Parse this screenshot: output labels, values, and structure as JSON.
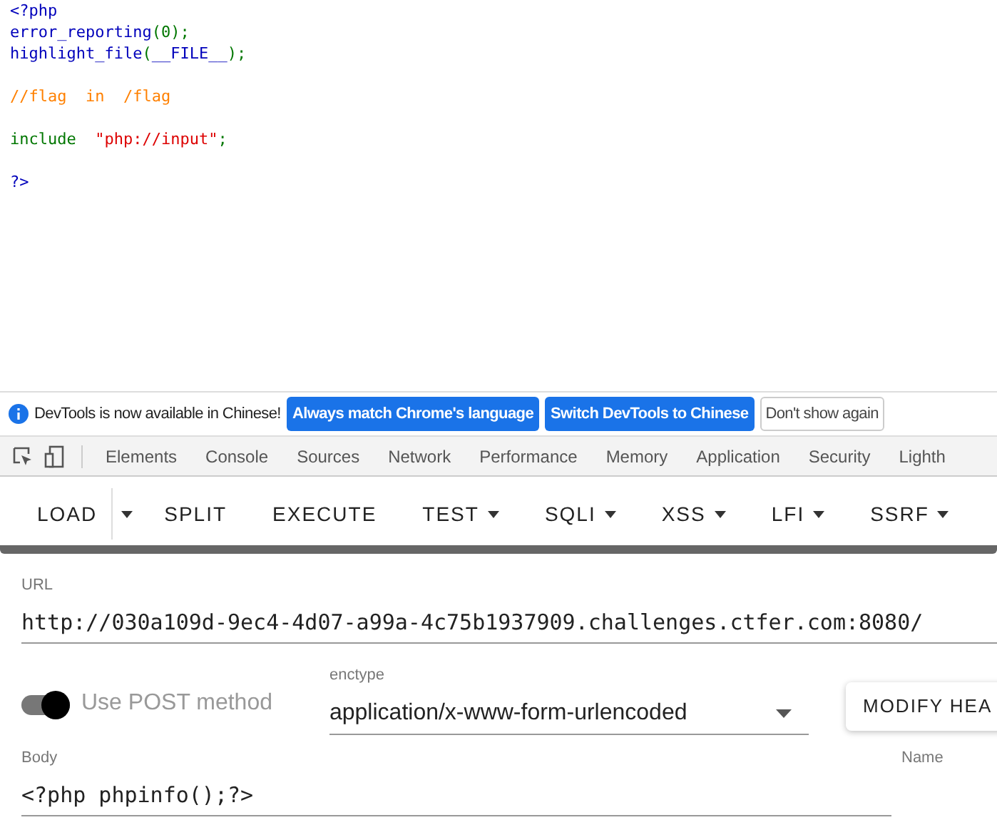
{
  "source_code": {
    "lines": [
      {
        "kind": "code",
        "tokens": [
          {
            "kind": "default",
            "text": "<?php"
          }
        ]
      },
      {
        "kind": "code",
        "tokens": [
          {
            "kind": "default",
            "text": "error_reporting"
          },
          {
            "kind": "keyword",
            "text": "(0);"
          }
        ]
      },
      {
        "kind": "code",
        "tokens": [
          {
            "kind": "default",
            "text": "highlight_file"
          },
          {
            "kind": "keyword",
            "text": "("
          },
          {
            "kind": "default",
            "text": "__FILE__"
          },
          {
            "kind": "keyword",
            "text": ");"
          }
        ]
      },
      {
        "kind": "blank"
      },
      {
        "kind": "code",
        "tokens": [
          {
            "kind": "comment",
            "text": "//flag  in  /flag"
          }
        ]
      },
      {
        "kind": "blank"
      },
      {
        "kind": "code",
        "tokens": [
          {
            "kind": "keyword",
            "text": "include  "
          },
          {
            "kind": "string",
            "text": "\"php://input\""
          },
          {
            "kind": "keyword",
            "text": ";"
          }
        ]
      },
      {
        "kind": "blank"
      },
      {
        "kind": "code",
        "tokens": [
          {
            "kind": "default",
            "text": "?>"
          }
        ]
      }
    ]
  },
  "devtools_infobar": {
    "message": "DevTools is now available in Chinese!",
    "buttons": [
      {
        "label": "Always match Chrome's language",
        "kind": "primary"
      },
      {
        "label": "Switch DevTools to Chinese",
        "kind": "primary"
      },
      {
        "label": "Don't show again",
        "kind": "secondary"
      }
    ]
  },
  "devtools_tabs": [
    {
      "label": "Elements",
      "selected": false
    },
    {
      "label": "Console",
      "selected": false
    },
    {
      "label": "Sources",
      "selected": false
    },
    {
      "label": "Network",
      "selected": false
    },
    {
      "label": "Performance",
      "selected": false
    },
    {
      "label": "Memory",
      "selected": false
    },
    {
      "label": "Application",
      "selected": false
    },
    {
      "label": "Security",
      "selected": false
    },
    {
      "label": "Lighth",
      "selected": false
    }
  ],
  "hackbar_toolbar": [
    {
      "label": "LOAD",
      "dropdown": false
    },
    {
      "label": "SPLIT",
      "dropdown": false
    },
    {
      "label": "EXECUTE",
      "dropdown": false
    },
    {
      "label": "TEST",
      "dropdown": true
    },
    {
      "label": "SQLI",
      "dropdown": true
    },
    {
      "label": "XSS",
      "dropdown": true
    },
    {
      "label": "LFI",
      "dropdown": true
    },
    {
      "label": "SSRF",
      "dropdown": true
    }
  ],
  "url_field": {
    "label": "URL",
    "value": "http://030a109d-9ec4-4d07-a99a-4c75b1937909.challenges.ctfer.com:8080/"
  },
  "post_toggle": {
    "label": "Use POST method",
    "on": true
  },
  "enctype": {
    "label": "enctype",
    "value": "application/x-www-form-urlencoded"
  },
  "modify_headers_button": {
    "label": "MODIFY HEA"
  },
  "body_field": {
    "label": "Body",
    "value": "<?php phpinfo();?>"
  },
  "name_column": {
    "label": "Name"
  }
}
